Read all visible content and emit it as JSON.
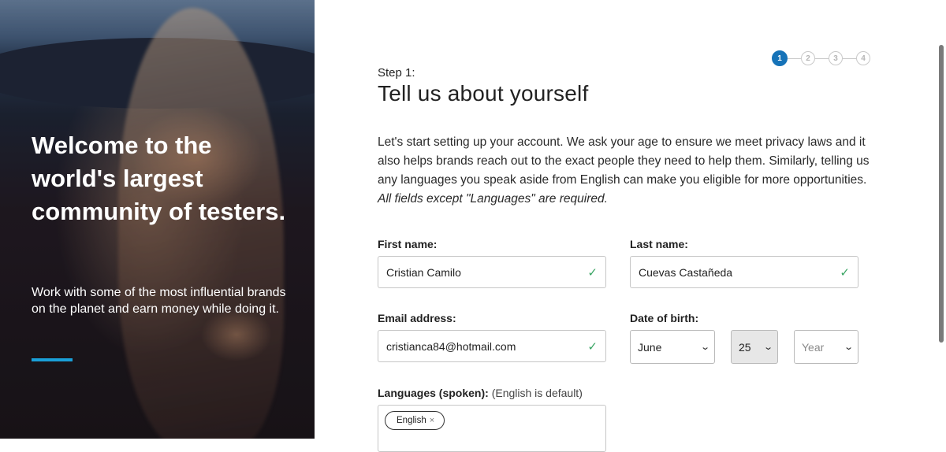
{
  "hero": {
    "title": "Welcome to the world's largest community of testers.",
    "subtitle": "Work with some of the most influential brands on the planet and earn money while doing it."
  },
  "stepper": {
    "current": 1,
    "steps": [
      "1",
      "2",
      "3",
      "4"
    ]
  },
  "form": {
    "step_label": "Step 1:",
    "title": "Tell us about yourself",
    "intro": "Let's start setting up your account. We ask your age to ensure we meet privacy laws and it also helps brands reach out to the exact people they need to help them. Similarly, telling us any languages you speak aside from English can make you eligible for more opportunities.",
    "intro_note": "All fields except \"Languages\" are required.",
    "first_name": {
      "label": "First name:",
      "value": "Cristian Camilo",
      "valid": true
    },
    "last_name": {
      "label": "Last name:",
      "value": "Cuevas Castañeda",
      "valid": true
    },
    "email": {
      "label": "Email address:",
      "value": "cristianca84@hotmail.com",
      "valid": true
    },
    "dob": {
      "label": "Date of birth:",
      "month": "June",
      "day": "25",
      "year_placeholder": "Year"
    },
    "languages": {
      "label": "Languages (spoken):",
      "note": "(English is default)",
      "tags": [
        "English"
      ]
    }
  },
  "icons": {
    "valid": "check-icon",
    "select": "chevron-down-icon",
    "remove_tag": "close-icon"
  },
  "colors": {
    "accent": "#1673b8",
    "hero_bar": "#1aa0d8",
    "valid": "#3aa564"
  }
}
